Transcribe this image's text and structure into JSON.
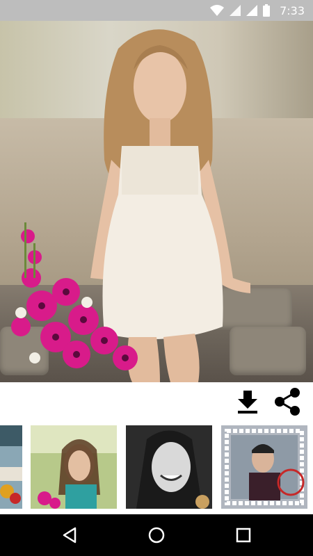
{
  "status_bar": {
    "time": "7:33",
    "icons": [
      "wifi-icon",
      "signal-icon",
      "signal-icon",
      "battery-icon"
    ]
  },
  "photo": {
    "description_icon": "photo-with-flower-frame"
  },
  "actions": {
    "download_icon": "download-icon",
    "share_icon": "share-icon"
  },
  "thumbnails": [
    {
      "name": "frame-thumb-1"
    },
    {
      "name": "frame-thumb-2"
    },
    {
      "name": "frame-thumb-3"
    },
    {
      "name": "frame-thumb-4"
    }
  ],
  "nav_bar": {
    "icons": [
      "back-icon",
      "home-icon",
      "recents-icon"
    ]
  },
  "colors": {
    "status_bar": "#bdbdbd",
    "nav_bar": "#000000",
    "flower_pink": "#d81b8a",
    "icon": "#000000"
  }
}
